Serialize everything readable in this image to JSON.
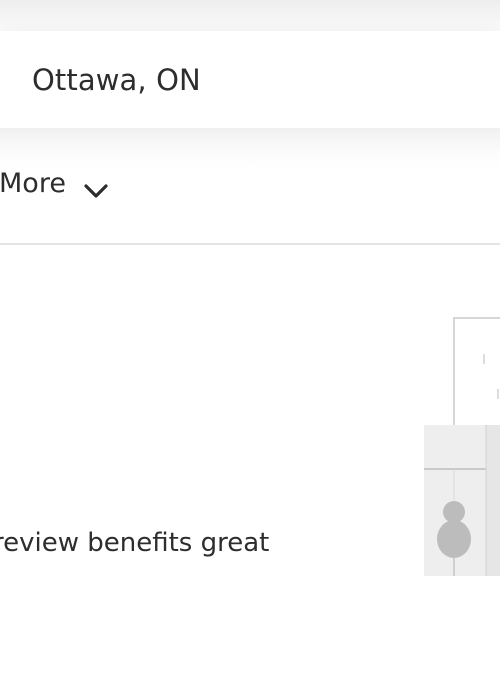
{
  "search": {
    "location_value": "Ottawa, ON"
  },
  "filters": {
    "more_label": "More"
  },
  "result": {
    "snippet": "review benefits great"
  },
  "icons": {
    "more_chevron": "chevron-down-icon",
    "illustration": "office-people-illustration"
  },
  "colors": {
    "text": "#2d2d2d",
    "divider": "#e4e4e4",
    "illustration_gray": "#bcbcbc"
  }
}
